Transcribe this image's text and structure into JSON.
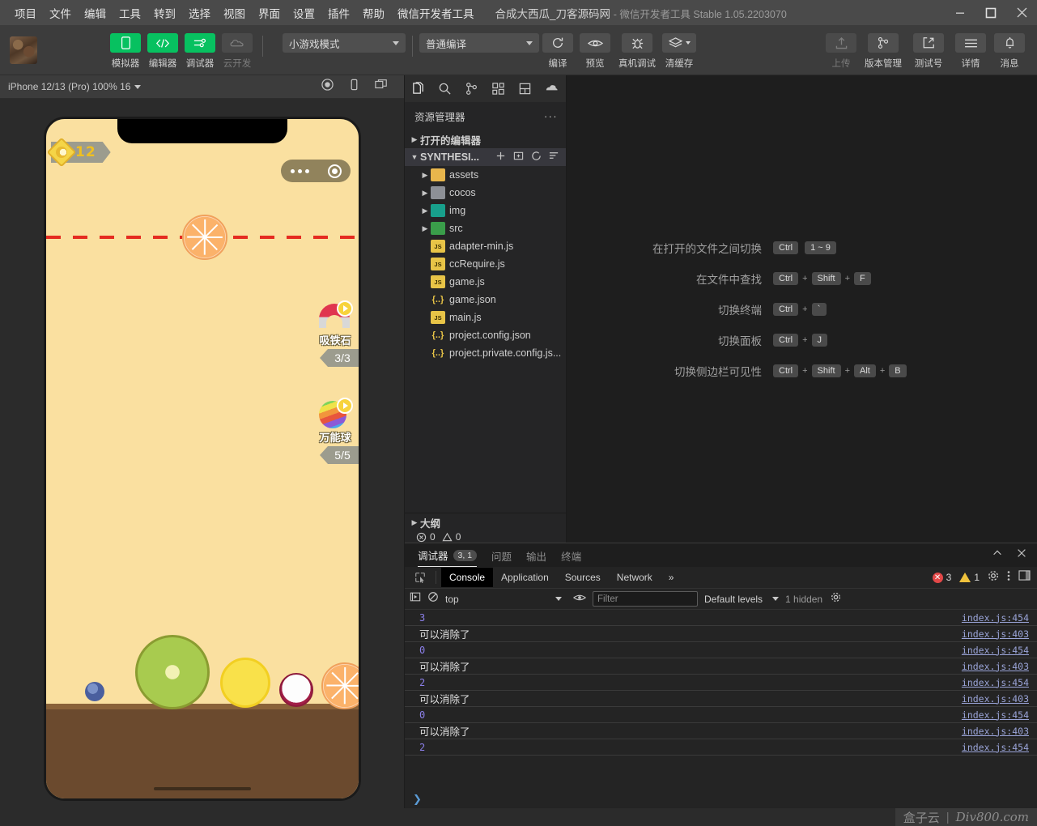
{
  "titlebar": {
    "menus": [
      "项目",
      "文件",
      "编辑",
      "工具",
      "转到",
      "选择",
      "视图",
      "界面",
      "设置",
      "插件",
      "帮助",
      "微信开发者工具"
    ],
    "project_title": "合成大西瓜_刀客源码网",
    "app_subtitle": "- 微信开发者工具 Stable 1.05.2203070",
    "window_controls": [
      "minimize-icon",
      "maximize-icon",
      "close-icon"
    ]
  },
  "toolbar": {
    "buttons": [
      {
        "label": "模拟器",
        "icon": "phone-icon",
        "style": "green"
      },
      {
        "label": "编辑器",
        "icon": "code-icon",
        "style": "green"
      },
      {
        "label": "调试器",
        "icon": "sliders-icon",
        "style": "green"
      },
      {
        "label": "云开发",
        "icon": "cloud-icon",
        "style": "grey"
      }
    ],
    "mode_select": "小游戏模式",
    "compile_select": "普通编译",
    "actions": [
      {
        "label": "编译",
        "icon": "refresh-icon"
      },
      {
        "label": "预览",
        "icon": "eye-icon"
      },
      {
        "label": "真机调试",
        "icon": "bug-icon"
      },
      {
        "label": "清缓存",
        "icon": "layers-icon"
      }
    ],
    "right_actions": [
      {
        "label": "上传",
        "icon": "upload-icon",
        "style": "grey"
      },
      {
        "label": "版本管理",
        "icon": "git-branch-icon",
        "style": "plain"
      },
      {
        "label": "测试号",
        "icon": "external-link-icon",
        "style": "plain"
      },
      {
        "label": "详情",
        "icon": "hamburger-icon",
        "style": "plain"
      },
      {
        "label": "消息",
        "icon": "bell-icon",
        "style": "plain"
      }
    ]
  },
  "simulator": {
    "device_label": "iPhone 12/13 (Pro) 100% 16",
    "bar_icons": [
      "record-icon",
      "rotate-device-icon",
      "detach-window-icon"
    ],
    "game": {
      "score": "12",
      "capsule_icons": [
        "more-dots-icon",
        "record-circle-icon"
      ],
      "powerups": [
        {
          "name": "吸铁石",
          "count": "3/3",
          "icon": "magnet-icon"
        },
        {
          "name": "万能球",
          "count": "5/5",
          "icon": "rainbow-ball-icon"
        }
      ],
      "fruits": [
        "orange-slice",
        "blueberry",
        "kiwi",
        "lemon",
        "mangosteen",
        "orange"
      ]
    }
  },
  "sidebar": {
    "activity_icons": [
      "explorer-icon",
      "search-icon",
      "source-control-icon",
      "extensions-icon",
      "layout-icon",
      "cloud-debug-icon"
    ],
    "title": "资源管理器",
    "more_label": "···",
    "sections": [
      {
        "label": "打开的编辑器",
        "expanded": false
      },
      {
        "label": "SYNTHESI...",
        "expanded": true
      }
    ],
    "section_actions": [
      "new-file-icon",
      "new-folder-icon",
      "refresh-icon",
      "collapse-all-icon"
    ],
    "files": [
      {
        "name": "assets",
        "type": "folder",
        "color": "folder-y",
        "glyph": ""
      },
      {
        "name": "cocos",
        "type": "folder",
        "color": "folder-g",
        "glyph": ""
      },
      {
        "name": "img",
        "type": "folder",
        "color": "folder-t",
        "glyph": ""
      },
      {
        "name": "src",
        "type": "folder",
        "color": "folder-gr",
        "glyph": ""
      },
      {
        "name": "adapter-min.js",
        "type": "js",
        "color": "js",
        "glyph": "JS"
      },
      {
        "name": "ccRequire.js",
        "type": "js",
        "color": "js",
        "glyph": "JS"
      },
      {
        "name": "game.js",
        "type": "js",
        "color": "js",
        "glyph": "JS"
      },
      {
        "name": "game.json",
        "type": "json",
        "color": "json",
        "glyph": "{..}"
      },
      {
        "name": "main.js",
        "type": "js",
        "color": "js",
        "glyph": "JS"
      },
      {
        "name": "project.config.json",
        "type": "json",
        "color": "json",
        "glyph": "{..}"
      },
      {
        "name": "project.private.config.js...",
        "type": "json",
        "color": "json",
        "glyph": "{..}"
      }
    ],
    "outline_label": "大纲",
    "problems": {
      "errors": "0",
      "warnings": "0"
    }
  },
  "welcome": {
    "shortcuts": [
      {
        "label": "在打开的文件之间切换",
        "keys": [
          "Ctrl",
          "1 ~ 9"
        ],
        "joiners": [
          ""
        ]
      },
      {
        "label": "在文件中查找",
        "keys": [
          "Ctrl",
          "Shift",
          "F"
        ],
        "joiners": [
          "+",
          "+"
        ]
      },
      {
        "label": "切换终端",
        "keys": [
          "Ctrl",
          "`"
        ],
        "joiners": [
          "+"
        ]
      },
      {
        "label": "切换面板",
        "keys": [
          "Ctrl",
          "J"
        ],
        "joiners": [
          "+"
        ]
      },
      {
        "label": "切换侧边栏可见性",
        "keys": [
          "Ctrl",
          "Shift",
          "Alt",
          "B"
        ],
        "joiners": [
          "+",
          "+",
          "+"
        ]
      }
    ]
  },
  "panel": {
    "tabs": [
      {
        "label": "调试器",
        "badge": "3, 1",
        "active": true
      },
      {
        "label": "问题",
        "badge": "",
        "active": false
      },
      {
        "label": "输出",
        "badge": "",
        "active": false
      },
      {
        "label": "终端",
        "badge": "",
        "active": false
      }
    ],
    "actions": [
      "collapse-icon",
      "close-icon"
    ],
    "devtools": {
      "tabs": [
        "Console",
        "Application",
        "Sources",
        "Network"
      ],
      "active_tab": "Console",
      "overflow_label": "»",
      "error_count": "3",
      "warning_count": "1",
      "right_icons": [
        "settings-gear-icon",
        "kebab-menu-icon",
        "dock-side-icon"
      ],
      "context": "top",
      "filter_placeholder": "Filter",
      "filter_value": "",
      "levels_label": "Default levels",
      "hidden_label": "1 hidden",
      "logs": [
        {
          "message": "3",
          "kind": "num",
          "source": "index.js:454"
        },
        {
          "message": "可以消除了",
          "kind": "text",
          "source": "index.js:403"
        },
        {
          "message": "0",
          "kind": "num",
          "source": "index.js:454"
        },
        {
          "message": "可以消除了",
          "kind": "text",
          "source": "index.js:403"
        },
        {
          "message": "2",
          "kind": "num",
          "source": "index.js:454"
        },
        {
          "message": "可以消除了",
          "kind": "text",
          "source": "index.js:403"
        },
        {
          "message": "0",
          "kind": "num",
          "source": "index.js:454"
        },
        {
          "message": "可以消除了",
          "kind": "text",
          "source": "index.js:403"
        },
        {
          "message": "2",
          "kind": "num",
          "source": "index.js:454"
        }
      ],
      "prompt": "❯"
    }
  },
  "watermark": {
    "left": "盒子云",
    "sep": "|",
    "right": "Div800.com"
  },
  "colors": {
    "accent_green": "#07c160",
    "titlebar": "#4a4a4a",
    "toolbar": "#3c3c3c",
    "editor_bg": "#1e1e1e",
    "sidebar_bg": "#252526"
  }
}
